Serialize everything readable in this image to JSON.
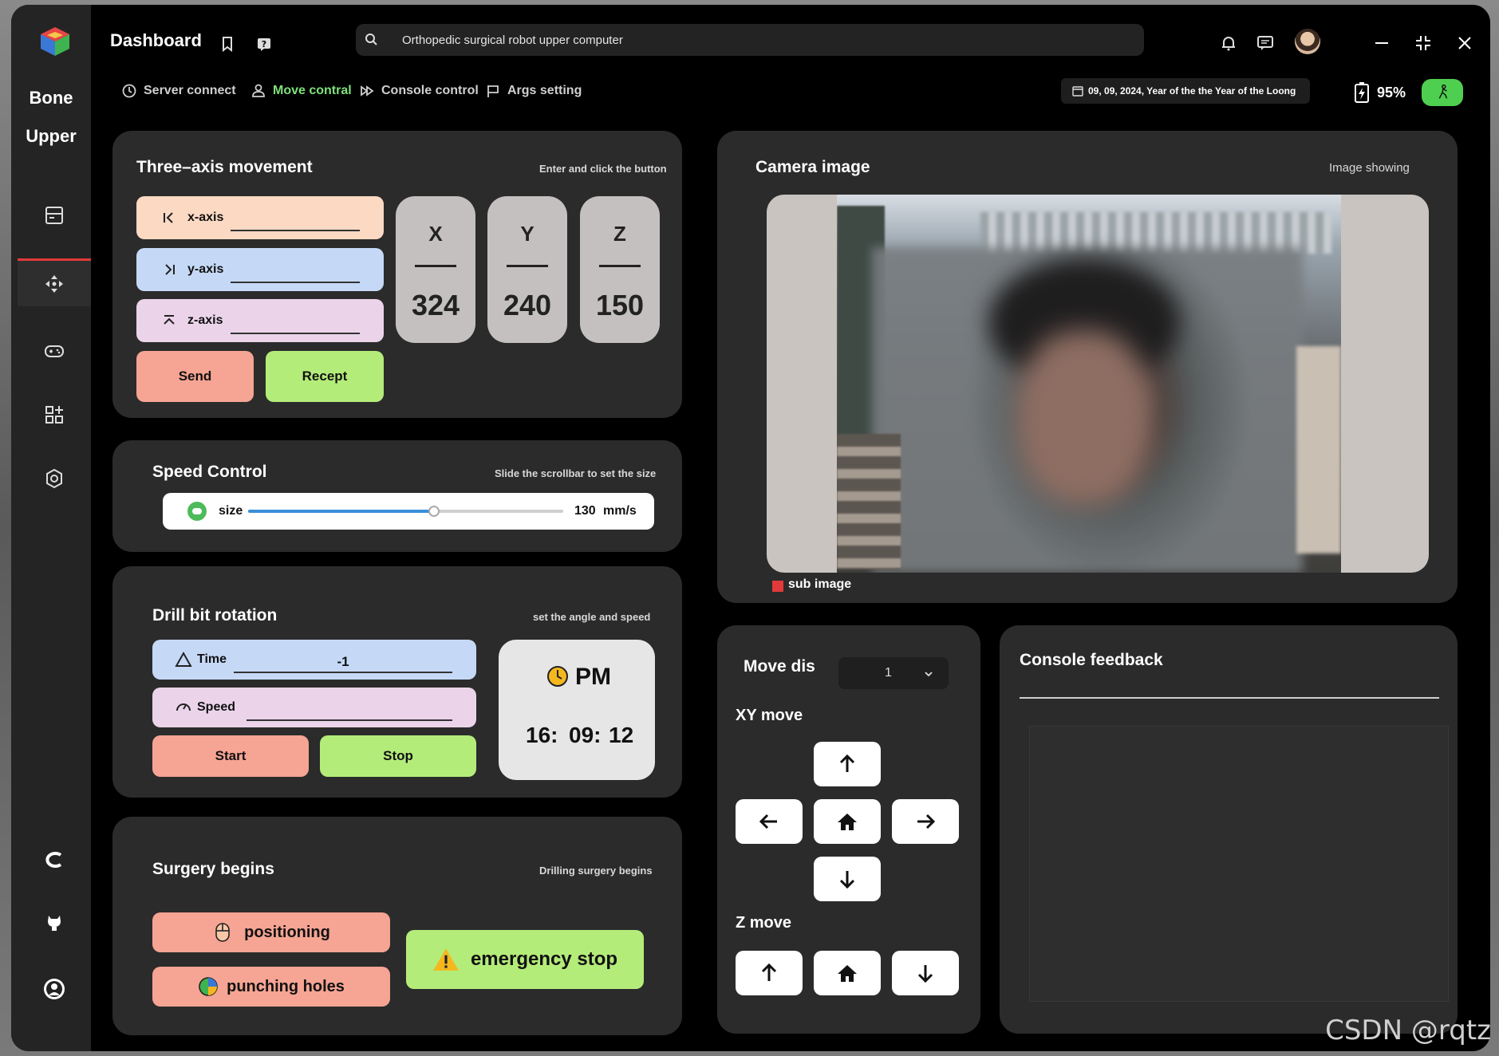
{
  "app": {
    "title": "Dashboard",
    "brand_line1": "Bone",
    "brand_line2": "Upper"
  },
  "search": {
    "text": "Orthopedic surgical robot upper computer"
  },
  "nav_tabs": [
    {
      "label": "Server connect",
      "icon": "clock-icon",
      "active": false
    },
    {
      "label": "Move contral",
      "icon": "people-icon",
      "active": true
    },
    {
      "label": "Console control",
      "icon": "fast-forward-icon",
      "active": false
    },
    {
      "label": "Args setting",
      "icon": "flag-icon",
      "active": false
    }
  ],
  "status": {
    "date_text": "09, 09, 2024, Year of the the Year of the Loong",
    "battery": "95%"
  },
  "sidebar_icons": [
    "layout-icon",
    "move-icon",
    "gamepad-icon",
    "apps-icon",
    "settings-icon",
    "c-logo-icon",
    "github-icon",
    "avatar-logo-icon"
  ],
  "three_axis": {
    "title": "Three–axis movement",
    "hint": "Enter and click the button",
    "fields": [
      {
        "label": "x-axis",
        "value": ""
      },
      {
        "label": "y-axis",
        "value": ""
      },
      {
        "label": "z-axis",
        "value": ""
      }
    ],
    "send_label": "Send",
    "recept_label": "Recept",
    "cards": [
      {
        "name": "X",
        "value": "324"
      },
      {
        "name": "Y",
        "value": "240"
      },
      {
        "name": "Z",
        "value": "150"
      }
    ]
  },
  "speed": {
    "title": "Speed Control",
    "hint": "Slide the scrollbar to set the size",
    "label": "size",
    "value": "130",
    "unit": "mm/s",
    "slider_fraction": 0.59
  },
  "drill": {
    "title": "Drill bit rotation",
    "hint": "set the angle and speed",
    "time_label": "Time",
    "time_value": "-1",
    "speed_label": "Speed",
    "speed_value": "",
    "start_label": "Start",
    "stop_label": "Stop",
    "clock_period": "PM",
    "clock_h": "16:",
    "clock_m": "09:",
    "clock_s": "12"
  },
  "surgery": {
    "title": "Surgery begins",
    "hint": "Drilling surgery begins",
    "positioning_label": "positioning",
    "punching_label": "punching holes",
    "emergency_label": "emergency stop"
  },
  "camera": {
    "title": "Camera image",
    "hint": "Image showing",
    "sub_label": "sub image"
  },
  "move": {
    "title": "Move dis",
    "selected": "1",
    "xy_label": "XY move",
    "z_label": "Z move"
  },
  "console": {
    "title": "Console feedback"
  },
  "watermark": "CSDN @rqtz",
  "colors": {
    "salmon": "#f6a493",
    "lime": "#b4ec7a",
    "active_tab": "#7fe07a",
    "accent_red": "#e23a3a"
  }
}
